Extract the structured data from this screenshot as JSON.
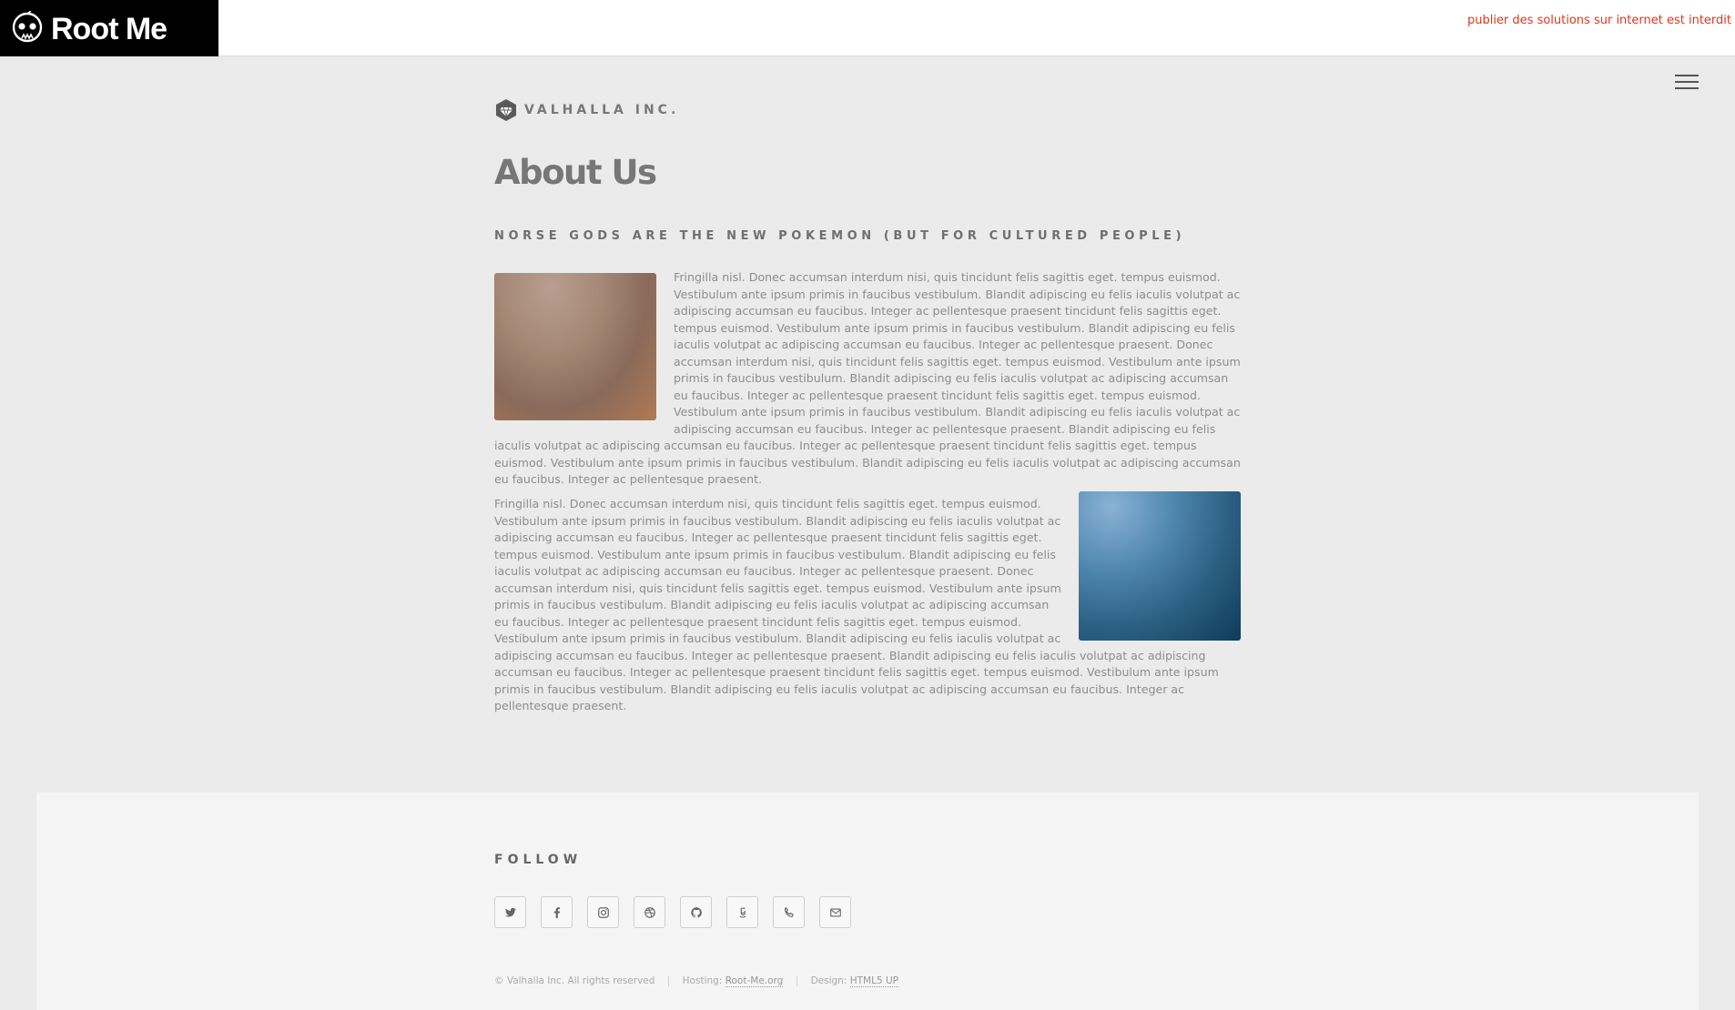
{
  "header": {
    "logo_text": "Root Me",
    "warning": "publier des solutions sur internet est interdit"
  },
  "brand": {
    "name": "VALHALLA INC."
  },
  "main": {
    "title": "About Us",
    "subtitle": "NORSE GODS ARE THE NEW POKEMON (BUT FOR CULTURED PEOPLE)",
    "paragraph_1": "Fringilla nisl. Donec accumsan interdum nisi, quis tincidunt felis sagittis eget. tempus euismod. Vestibulum ante ipsum primis in faucibus vestibulum. Blandit adipiscing eu felis iaculis volutpat ac adipiscing accumsan eu faucibus. Integer ac pellentesque praesent tincidunt felis sagittis eget. tempus euismod. Vestibulum ante ipsum primis in faucibus vestibulum. Blandit adipiscing eu felis iaculis volutpat ac adipiscing accumsan eu faucibus. Integer ac pellentesque praesent. Donec accumsan interdum nisi, quis tincidunt felis sagittis eget. tempus euismod. Vestibulum ante ipsum primis in faucibus vestibulum. Blandit adipiscing eu felis iaculis volutpat ac adipiscing accumsan eu faucibus. Integer ac pellentesque praesent tincidunt felis sagittis eget. tempus euismod. Vestibulum ante ipsum primis in faucibus vestibulum. Blandit adipiscing eu felis iaculis volutpat ac adipiscing accumsan eu faucibus. Integer ac pellentesque praesent. Blandit adipiscing eu felis iaculis volutpat ac adipiscing accumsan eu faucibus. Integer ac pellentesque praesent tincidunt felis sagittis eget. tempus euismod. Vestibulum ante ipsum primis in faucibus vestibulum. Blandit adipiscing eu felis iaculis volutpat ac adipiscing accumsan eu faucibus. Integer ac pellentesque praesent.",
    "paragraph_2": "Fringilla nisl. Donec accumsan interdum nisi, quis tincidunt felis sagittis eget. tempus euismod. Vestibulum ante ipsum primis in faucibus vestibulum. Blandit adipiscing eu felis iaculis volutpat ac adipiscing accumsan eu faucibus. Integer ac pellentesque praesent tincidunt felis sagittis eget. tempus euismod. Vestibulum ante ipsum primis in faucibus vestibulum. Blandit adipiscing eu felis iaculis volutpat ac adipiscing accumsan eu faucibus. Integer ac pellentesque praesent. Donec accumsan interdum nisi, quis tincidunt felis sagittis eget. tempus euismod. Vestibulum ante ipsum primis in faucibus vestibulum. Blandit adipiscing eu felis iaculis volutpat ac adipiscing accumsan eu faucibus. Integer ac pellentesque praesent tincidunt felis sagittis eget. tempus euismod. Vestibulum ante ipsum primis in faucibus vestibulum. Blandit adipiscing eu felis iaculis volutpat ac adipiscing accumsan eu faucibus. Integer ac pellentesque praesent. Blandit adipiscing eu felis iaculis volutpat ac adipiscing accumsan eu faucibus. Integer ac pellentesque praesent tincidunt felis sagittis eget. tempus euismod. Vestibulum ante ipsum primis in faucibus vestibulum. Blandit adipiscing eu felis iaculis volutpat ac adipiscing accumsan eu faucibus. Integer ac pellentesque praesent."
  },
  "footer": {
    "follow_label": "FOLLOW",
    "social_icons": [
      "twitter-icon",
      "facebook-icon",
      "instagram-icon",
      "dribbble-icon",
      "github-icon",
      "500px-icon",
      "phone-icon",
      "envelope-icon"
    ],
    "copyright": "© Valhalla Inc. All rights reserved",
    "hosting_label": "Hosting:",
    "hosting_link": "Root-Me.org",
    "design_label": "Design:",
    "design_link": "HTML5 UP"
  },
  "colors": {
    "warning": "#e0341c",
    "page_bg": "#ebebeb",
    "footer_bg": "#f5f5f5"
  }
}
